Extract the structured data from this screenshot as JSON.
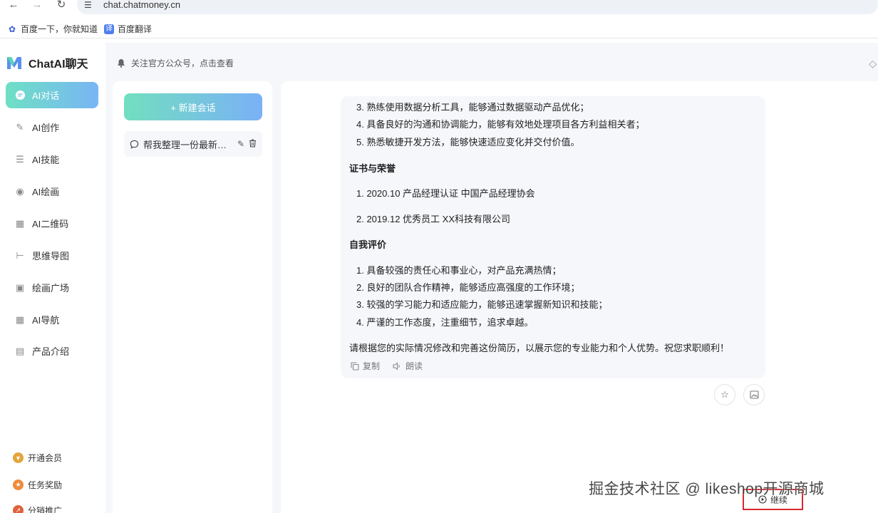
{
  "browser": {
    "url": "chat.chatmoney.cn",
    "bookmarks": [
      {
        "label": "百度一下，你就知道"
      },
      {
        "label": "百度翻译",
        "icon_text": "译"
      }
    ]
  },
  "sidebar": {
    "app_name": "ChatAI聊天",
    "menu": [
      {
        "label": "AI对话",
        "icon": "chat-bubble-icon",
        "active": true
      },
      {
        "label": "AI创作",
        "icon": "pen-icon"
      },
      {
        "label": "AI技能",
        "icon": "list-icon"
      },
      {
        "label": "AI绘画",
        "icon": "palette-icon"
      },
      {
        "label": "AI二维码",
        "icon": "qrcode-icon"
      },
      {
        "label": "思维导图",
        "icon": "mindmap-icon"
      },
      {
        "label": "绘画广场",
        "icon": "image-icon"
      },
      {
        "label": "AI导航",
        "icon": "grid-icon"
      },
      {
        "label": "产品介绍",
        "icon": "document-icon"
      }
    ],
    "footer": [
      {
        "label": "开通会员",
        "icon": "vip-icon"
      },
      {
        "label": "任务奖励",
        "icon": "task-icon"
      },
      {
        "label": "分销推广",
        "icon": "share-icon"
      }
    ]
  },
  "topbar": {
    "notice": "关注官方公众号，点击查看"
  },
  "conversations": {
    "new_label": "+ 新建会话",
    "items": [
      {
        "title": "帮我整理一份最新的产品经理简历"
      }
    ]
  },
  "chat": {
    "list1": [
      "3. 熟练使用数据分析工具，能够通过数据驱动产品优化；",
      "4. 具备良好的沟通和协调能力，能够有效地处理项目各方利益相关者；",
      "5. 熟悉敏捷开发方法，能够快速适应变化并交付价值。"
    ],
    "section_cert": "证书与荣誉",
    "certs": [
      "1. 2020.10 产品经理认证 中国产品经理协会",
      "2. 2019.12 优秀员工 XX科技有限公司"
    ],
    "section_self": "自我评价",
    "self_eval": [
      "1. 具备较强的责任心和事业心，对产品充满热情；",
      "2. 良好的团队合作精神，能够适应高强度的工作环境；",
      "3. 较强的学习能力和适应能力，能够迅速掌握新知识和技能；",
      "4. 严谨的工作态度，注重细节，追求卓越。"
    ],
    "closing": "请根据您的实际情况修改和完善这份简历，以展示您的专业能力和个人优势。祝您求职顺利！",
    "copy_label": "复制",
    "read_label": "朗读",
    "continue_label": "继续"
  },
  "watermark": "掘金技术社区 @ likeshop开源商城",
  "colors": {
    "accent_gradient_start": "#6ee0c4",
    "accent_gradient_end": "#79b5f5",
    "panel_bg": "#f5f7fb",
    "highlight_border": "#d9282f"
  }
}
